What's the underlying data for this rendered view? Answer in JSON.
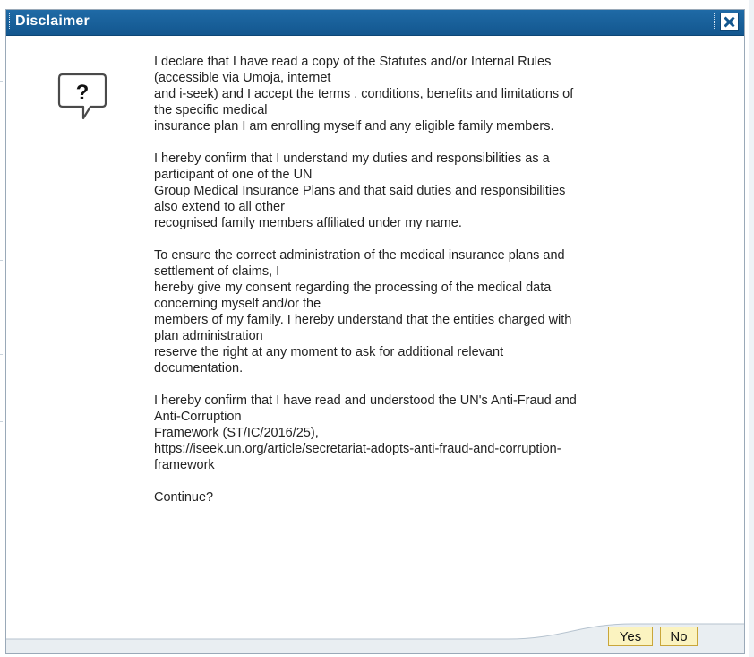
{
  "dialog": {
    "title": "Disclaimer",
    "close_icon": "close-icon",
    "help_icon": "question-speech-bubble-icon",
    "paragraphs": [
      "I declare that I have read a copy of the Statutes and/or Internal Rules\n(accessible via Umoja, internet\nand i-seek) and I accept the terms , conditions, benefits and limitations of\nthe specific medical\ninsurance plan I am enrolling myself and any eligible family members.",
      "I hereby confirm that I understand my duties and responsibilities as a\nparticipant of one of the UN\nGroup Medical Insurance Plans and that said duties and responsibilities\nalso extend to all other\nrecognised family members affiliated under my name.",
      "To ensure the correct administration of the medical insurance plans and\nsettlement of claims, I\nhereby give my consent regarding the processing of the medical data\nconcerning myself and/or the\nmembers of my family. I hereby understand that the entities charged with\nplan administration\nreserve the right at any moment to ask for additional relevant\ndocumentation.",
      "I hereby confirm that I have read and understood the UN's Anti-Fraud and\nAnti-Corruption\nFramework (ST/IC/2016/25),\nhttps://iseek.un.org/article/secretariat-adopts-anti-fraud-and-corruption-\nframework"
    ],
    "question": "Continue?",
    "buttons": {
      "yes": "Yes",
      "no": "No"
    }
  },
  "colors": {
    "titlebar": "#1f6aa6",
    "button_bg": "#fbf3c0",
    "button_border": "#c9a63a",
    "footer_bg": "#e9eef2"
  }
}
